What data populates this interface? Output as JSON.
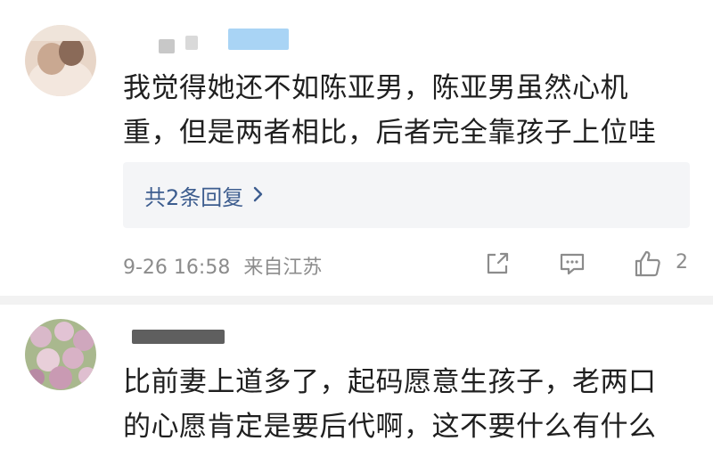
{
  "comments": [
    {
      "text": "我觉得她还不如陈亚男，陈亚男虽然心机\n重，但是两者相比，后者完全靠孩子上位哇",
      "replies_label": "共2条回复",
      "replies_chevron": "chevron-right-icon",
      "timestamp": "9-26 16:58",
      "location": "来自江苏",
      "share_icon": "share-icon",
      "reply_icon": "comment-icon",
      "like_icon": "thumbs-up-icon",
      "like_count": "2"
    },
    {
      "text": "比前妻上道多了，起码愿意生孩子，老两口\n的心愿肯定是要后代啊，这不要什么有什么"
    }
  ],
  "colors": {
    "link": "#3d5d8f",
    "meta": "#8c8c8c",
    "reply_box_bg": "#f4f5f7"
  }
}
